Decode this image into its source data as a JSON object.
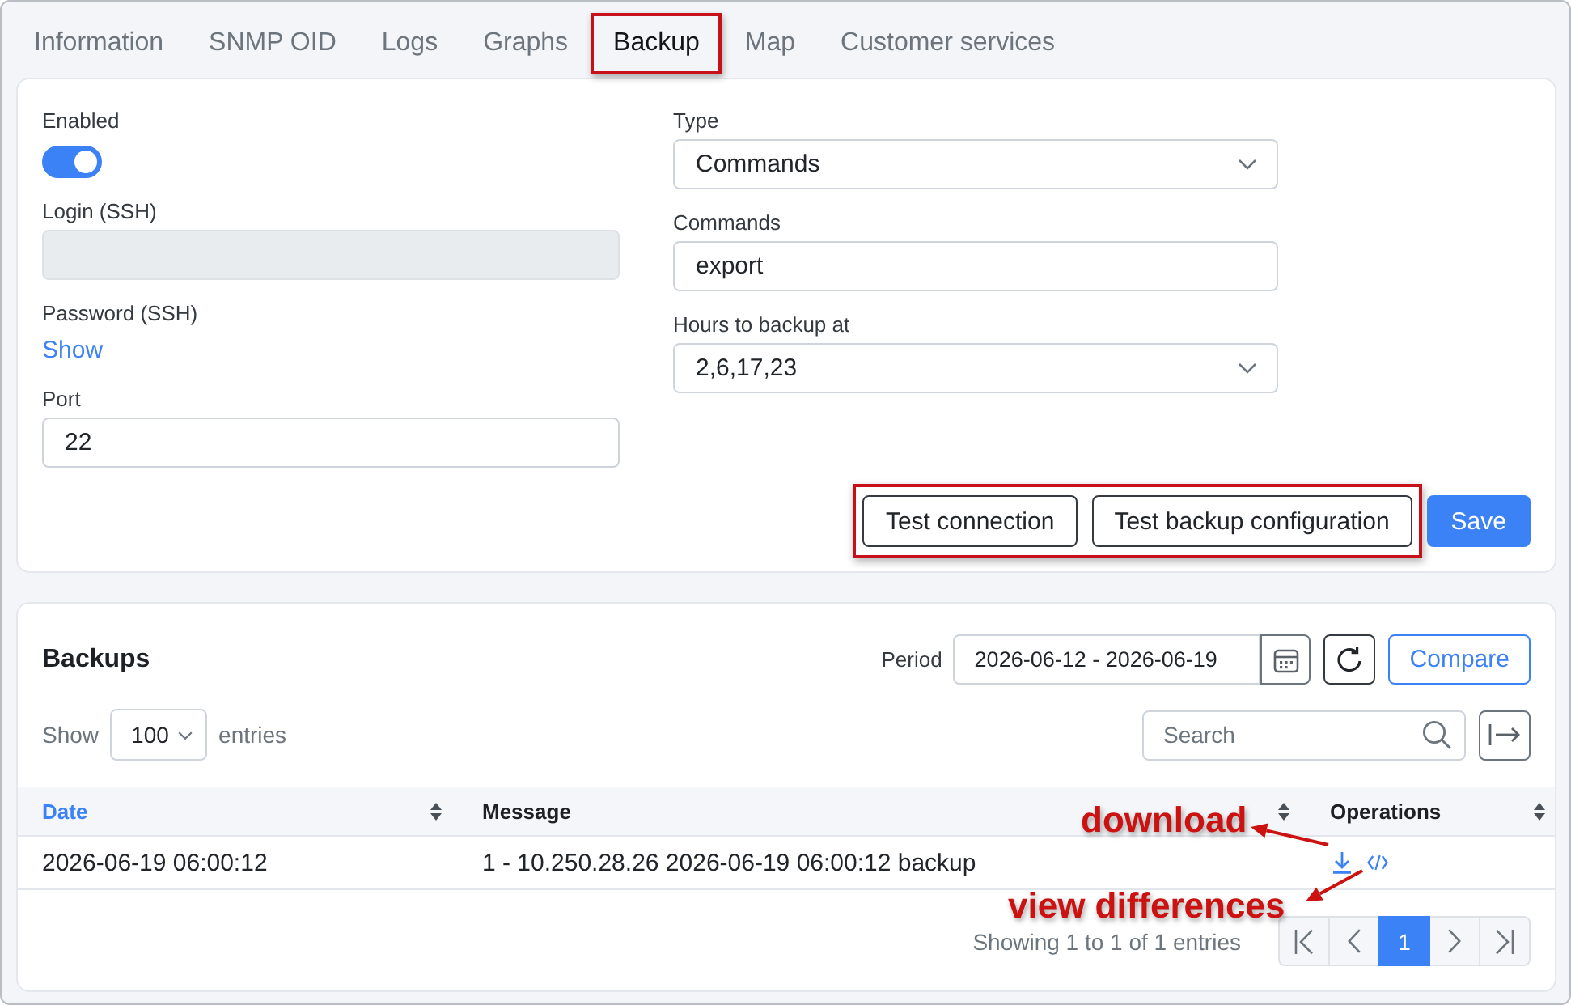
{
  "tabs": [
    {
      "label": "Information",
      "selected": false,
      "highlighted": false
    },
    {
      "label": "SNMP OID",
      "selected": false,
      "highlighted": false
    },
    {
      "label": "Logs",
      "selected": false,
      "highlighted": false
    },
    {
      "label": "Graphs",
      "selected": false,
      "highlighted": false
    },
    {
      "label": "Backup",
      "selected": true,
      "highlighted": true
    },
    {
      "label": "Map",
      "selected": false,
      "highlighted": false
    },
    {
      "label": "Customer services",
      "selected": false,
      "highlighted": false
    }
  ],
  "settings": {
    "columns": [
      [
        {
          "kind": "toggle",
          "label": "Enabled",
          "on": true
        },
        {
          "kind": "input",
          "label": "Login (SSH)",
          "disabled": true
        },
        {
          "kind": "link",
          "label": "Password (SSH)",
          "link": "Show"
        },
        {
          "kind": "input",
          "label": "Port",
          "value": "22",
          "disabled": false
        }
      ],
      [
        {
          "kind": "select",
          "label": "Type",
          "value": "Commands"
        },
        {
          "kind": "input",
          "label": "Commands",
          "value": "export",
          "disabled": false
        },
        {
          "kind": "select",
          "label": "Hours to backup at",
          "value": "2,6,17,23"
        }
      ]
    ],
    "action_groups": [
      {
        "highlighted": true,
        "buttons": [
          {
            "label": "Test connection",
            "kind": "secondary"
          },
          {
            "label": "Test backup configuration",
            "kind": "secondary"
          }
        ]
      },
      {
        "highlighted": false,
        "buttons": [
          {
            "label": "Save",
            "kind": "primary"
          }
        ]
      }
    ]
  },
  "backups": {
    "title": "Backups",
    "period": {
      "label": "Period",
      "value": "2026-06-12 - 2026-06-19"
    },
    "compare_button": "Compare",
    "length": {
      "before": "Show",
      "value": "100",
      "after": "entries"
    },
    "search": {
      "placeholder": "Search"
    },
    "table": {
      "columns": [
        {
          "label": "Date",
          "sorted": true
        },
        {
          "label": "Message",
          "sorted": false
        },
        {
          "label": "Operations",
          "sorted": false
        }
      ],
      "rows": [
        {
          "cells": [
            "2026-06-19 06:00:12",
            "1 - 10.250.28.26 2026-06-19 06:00:12 backup"
          ]
        }
      ]
    },
    "info": "Showing 1 to 1 of 1 entries",
    "pages": [
      {
        "label": "1",
        "selected": true
      }
    ]
  },
  "annotations": [
    {
      "text": "download"
    },
    {
      "text": "view differences"
    }
  ]
}
